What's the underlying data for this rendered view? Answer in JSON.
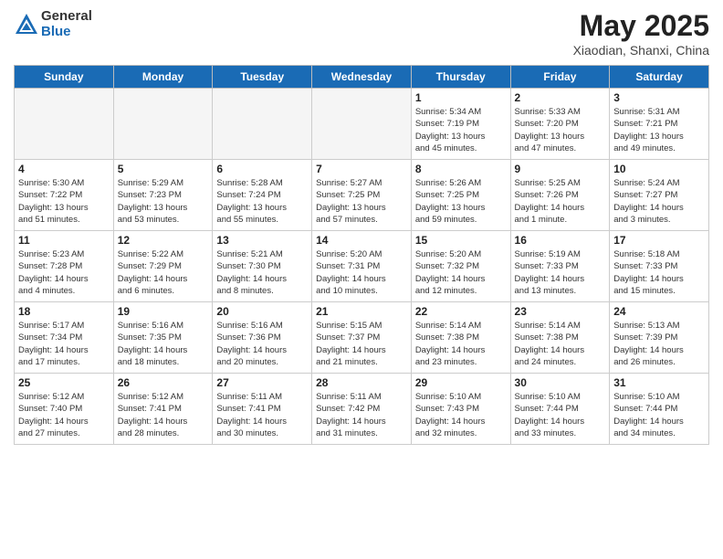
{
  "header": {
    "logo_line1": "General",
    "logo_line2": "Blue",
    "month": "May 2025",
    "location": "Xiaodian, Shanxi, China"
  },
  "days_of_week": [
    "Sunday",
    "Monday",
    "Tuesday",
    "Wednesday",
    "Thursday",
    "Friday",
    "Saturday"
  ],
  "weeks": [
    [
      {
        "day": "",
        "info": ""
      },
      {
        "day": "",
        "info": ""
      },
      {
        "day": "",
        "info": ""
      },
      {
        "day": "",
        "info": ""
      },
      {
        "day": "1",
        "info": "Sunrise: 5:34 AM\nSunset: 7:19 PM\nDaylight: 13 hours\nand 45 minutes."
      },
      {
        "day": "2",
        "info": "Sunrise: 5:33 AM\nSunset: 7:20 PM\nDaylight: 13 hours\nand 47 minutes."
      },
      {
        "day": "3",
        "info": "Sunrise: 5:31 AM\nSunset: 7:21 PM\nDaylight: 13 hours\nand 49 minutes."
      }
    ],
    [
      {
        "day": "4",
        "info": "Sunrise: 5:30 AM\nSunset: 7:22 PM\nDaylight: 13 hours\nand 51 minutes."
      },
      {
        "day": "5",
        "info": "Sunrise: 5:29 AM\nSunset: 7:23 PM\nDaylight: 13 hours\nand 53 minutes."
      },
      {
        "day": "6",
        "info": "Sunrise: 5:28 AM\nSunset: 7:24 PM\nDaylight: 13 hours\nand 55 minutes."
      },
      {
        "day": "7",
        "info": "Sunrise: 5:27 AM\nSunset: 7:25 PM\nDaylight: 13 hours\nand 57 minutes."
      },
      {
        "day": "8",
        "info": "Sunrise: 5:26 AM\nSunset: 7:25 PM\nDaylight: 13 hours\nand 59 minutes."
      },
      {
        "day": "9",
        "info": "Sunrise: 5:25 AM\nSunset: 7:26 PM\nDaylight: 14 hours\nand 1 minute."
      },
      {
        "day": "10",
        "info": "Sunrise: 5:24 AM\nSunset: 7:27 PM\nDaylight: 14 hours\nand 3 minutes."
      }
    ],
    [
      {
        "day": "11",
        "info": "Sunrise: 5:23 AM\nSunset: 7:28 PM\nDaylight: 14 hours\nand 4 minutes."
      },
      {
        "day": "12",
        "info": "Sunrise: 5:22 AM\nSunset: 7:29 PM\nDaylight: 14 hours\nand 6 minutes."
      },
      {
        "day": "13",
        "info": "Sunrise: 5:21 AM\nSunset: 7:30 PM\nDaylight: 14 hours\nand 8 minutes."
      },
      {
        "day": "14",
        "info": "Sunrise: 5:20 AM\nSunset: 7:31 PM\nDaylight: 14 hours\nand 10 minutes."
      },
      {
        "day": "15",
        "info": "Sunrise: 5:20 AM\nSunset: 7:32 PM\nDaylight: 14 hours\nand 12 minutes."
      },
      {
        "day": "16",
        "info": "Sunrise: 5:19 AM\nSunset: 7:33 PM\nDaylight: 14 hours\nand 13 minutes."
      },
      {
        "day": "17",
        "info": "Sunrise: 5:18 AM\nSunset: 7:33 PM\nDaylight: 14 hours\nand 15 minutes."
      }
    ],
    [
      {
        "day": "18",
        "info": "Sunrise: 5:17 AM\nSunset: 7:34 PM\nDaylight: 14 hours\nand 17 minutes."
      },
      {
        "day": "19",
        "info": "Sunrise: 5:16 AM\nSunset: 7:35 PM\nDaylight: 14 hours\nand 18 minutes."
      },
      {
        "day": "20",
        "info": "Sunrise: 5:16 AM\nSunset: 7:36 PM\nDaylight: 14 hours\nand 20 minutes."
      },
      {
        "day": "21",
        "info": "Sunrise: 5:15 AM\nSunset: 7:37 PM\nDaylight: 14 hours\nand 21 minutes."
      },
      {
        "day": "22",
        "info": "Sunrise: 5:14 AM\nSunset: 7:38 PM\nDaylight: 14 hours\nand 23 minutes."
      },
      {
        "day": "23",
        "info": "Sunrise: 5:14 AM\nSunset: 7:38 PM\nDaylight: 14 hours\nand 24 minutes."
      },
      {
        "day": "24",
        "info": "Sunrise: 5:13 AM\nSunset: 7:39 PM\nDaylight: 14 hours\nand 26 minutes."
      }
    ],
    [
      {
        "day": "25",
        "info": "Sunrise: 5:12 AM\nSunset: 7:40 PM\nDaylight: 14 hours\nand 27 minutes."
      },
      {
        "day": "26",
        "info": "Sunrise: 5:12 AM\nSunset: 7:41 PM\nDaylight: 14 hours\nand 28 minutes."
      },
      {
        "day": "27",
        "info": "Sunrise: 5:11 AM\nSunset: 7:41 PM\nDaylight: 14 hours\nand 30 minutes."
      },
      {
        "day": "28",
        "info": "Sunrise: 5:11 AM\nSunset: 7:42 PM\nDaylight: 14 hours\nand 31 minutes."
      },
      {
        "day": "29",
        "info": "Sunrise: 5:10 AM\nSunset: 7:43 PM\nDaylight: 14 hours\nand 32 minutes."
      },
      {
        "day": "30",
        "info": "Sunrise: 5:10 AM\nSunset: 7:44 PM\nDaylight: 14 hours\nand 33 minutes."
      },
      {
        "day": "31",
        "info": "Sunrise: 5:10 AM\nSunset: 7:44 PM\nDaylight: 14 hours\nand 34 minutes."
      }
    ]
  ]
}
